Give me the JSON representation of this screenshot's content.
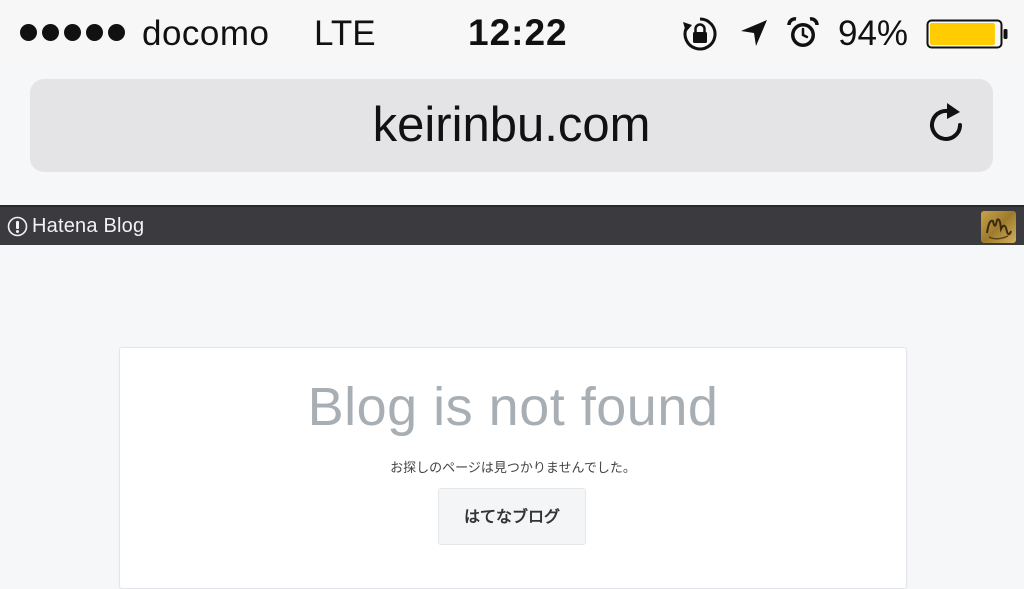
{
  "status_bar": {
    "signal_dots": 5,
    "carrier": "docomo",
    "network": "LTE",
    "time": "12:22",
    "battery_percent": "94%",
    "battery_level": 0.94,
    "battery_color": "#ffcc00",
    "icons": [
      "rotation-lock-icon",
      "location-arrow-icon",
      "alarm-clock-icon",
      "battery-icon"
    ]
  },
  "address_bar": {
    "url": "keirinbu.com",
    "reload_icon": "reload-icon"
  },
  "hatena_bar": {
    "brand": "Hatena Blog",
    "logo_icon": "hatena-logo-icon",
    "bar_color": "#3a3a3f"
  },
  "main": {
    "title": "Blog is not found",
    "message": "お探しのページは見つかりませんでした。",
    "button_label": "はてなブログ"
  }
}
